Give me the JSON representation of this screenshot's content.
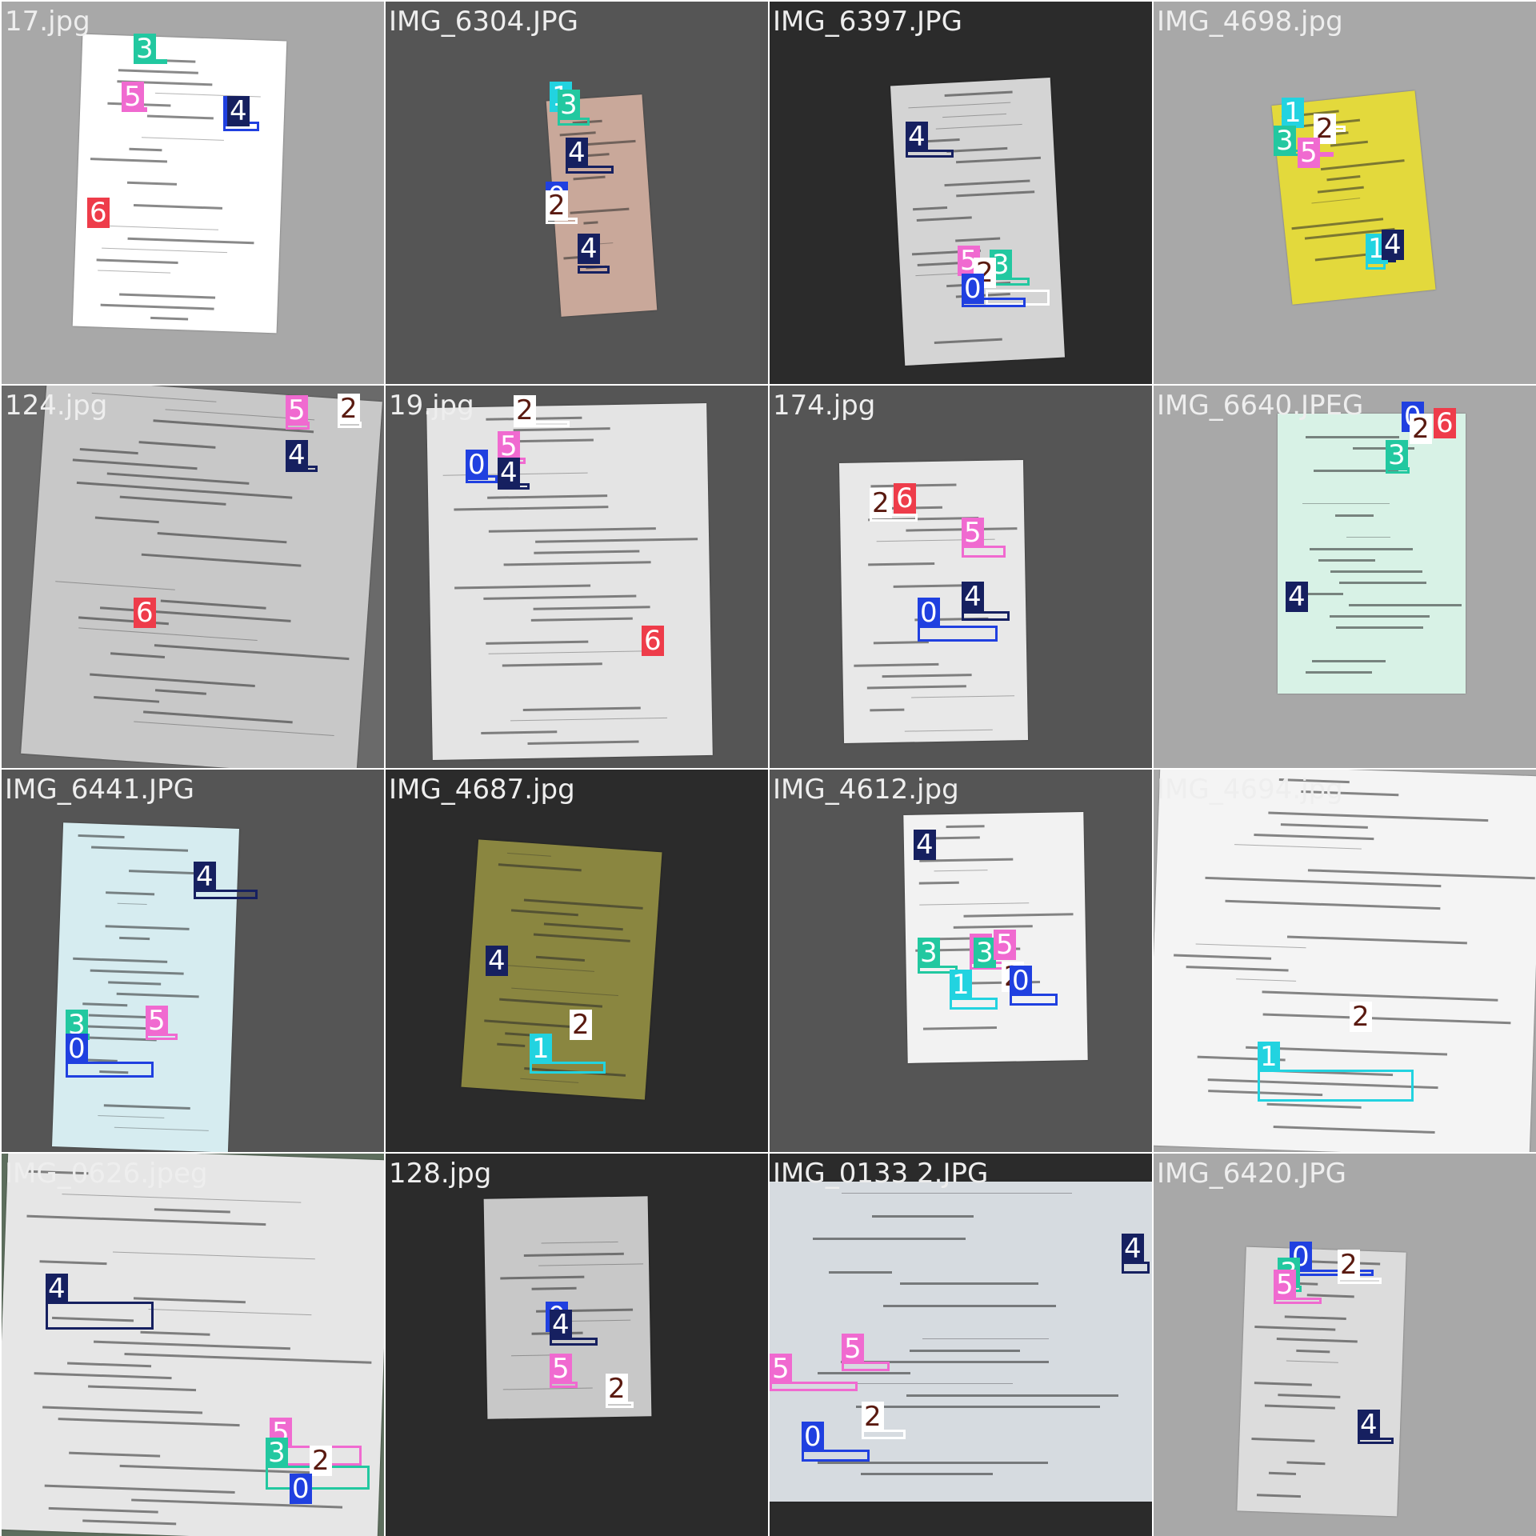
{
  "palette": {
    "0": "#2040e0",
    "1": "#22d3e0",
    "2": "#ffffff",
    "3": "#22c8a0",
    "4": "#162060",
    "5": "#f06ad0",
    "6": "#ee3c4a"
  },
  "tag_text_colors": {
    "0": "#ffffff",
    "1": "#ffffff",
    "2": "#5a1a10",
    "3": "#ffffff",
    "4": "#ffffff",
    "5": "#ffffff",
    "6": "#ffffff"
  },
  "cells": [
    {
      "title": "17.jpg",
      "background": "#a8a8a8",
      "doc": {
        "color": "#ffffff",
        "rotate": 2
      },
      "labels": [
        "3",
        "5",
        "0",
        "4",
        "6"
      ]
    },
    {
      "title": "IMG_6304.JPG",
      "background": "#555555",
      "doc": {
        "color": "#c9a89a",
        "rotate": -4
      },
      "labels": [
        "1",
        "3",
        "4",
        "0",
        "2",
        "4"
      ]
    },
    {
      "title": "IMG_6397.JPG",
      "background": "#2b2b2b",
      "doc": {
        "color": "#d4d4d4",
        "rotate": -3
      },
      "labels": [
        "4",
        "5",
        "3",
        "2",
        "0"
      ]
    },
    {
      "title": "IMG_4698.jpg",
      "background": "#a8a8a8",
      "doc": {
        "color": "#e3d93c",
        "rotate": -6
      },
      "labels": [
        "1",
        "2",
        "3",
        "5",
        "1",
        "4"
      ]
    },
    {
      "title": "124.jpg",
      "background": "#6a6a6a",
      "doc": {
        "color": "#c8c8c8",
        "rotate": 4
      },
      "labels": [
        "5",
        "2",
        "4",
        "6"
      ]
    },
    {
      "title": "19.jpg",
      "background": "#555555",
      "doc": {
        "color": "#e4e4e4",
        "rotate": -1
      },
      "labels": [
        "2",
        "5",
        "0",
        "4",
        "6"
      ]
    },
    {
      "title": "174.jpg",
      "background": "#555555",
      "doc": {
        "color": "#e8e8e8",
        "rotate": -1
      },
      "labels": [
        "2",
        "6",
        "5",
        "4",
        "0"
      ]
    },
    {
      "title": "IMG_6640.JPEG",
      "background": "#a8a8a8",
      "doc": {
        "color": "#d8f2e6",
        "rotate": 0
      },
      "labels": [
        "0",
        "2",
        "6",
        "3",
        "4"
      ]
    },
    {
      "title": "IMG_6441.JPG",
      "background": "#555555",
      "doc": {
        "color": "#d6ecf0",
        "rotate": 2
      },
      "labels": [
        "4",
        "3",
        "5",
        "0"
      ]
    },
    {
      "title": "IMG_4687.jpg",
      "background": "#2b2b2b",
      "doc": {
        "color": "#8a8640",
        "rotate": 4
      },
      "labels": [
        "4",
        "1",
        "2"
      ]
    },
    {
      "title": "IMG_4612.jpg",
      "background": "#555555",
      "doc": {
        "color": "#f2f2f2",
        "rotate": -1
      },
      "labels": [
        "4",
        "3",
        "5",
        "3",
        "5",
        "2",
        "1",
        "0"
      ]
    },
    {
      "title": "IMG_4694.jpg",
      "background": "#a8a8a8",
      "doc": {
        "color": "#f4f4f4",
        "rotate": 2
      },
      "labels": [
        "2",
        "1"
      ]
    },
    {
      "title": "IMG_0626.jpeg",
      "background": "#5d6e5d",
      "doc": {
        "color": "#e6e6e6",
        "rotate": 2
      },
      "labels": [
        "4",
        "5",
        "3",
        "2",
        "0"
      ]
    },
    {
      "title": "128.jpg",
      "background": "#2b2b2b",
      "doc": {
        "color": "#c8c8c8",
        "rotate": -1
      },
      "labels": [
        "0",
        "4",
        "5",
        "2"
      ]
    },
    {
      "title": "IMG_0133 2.JPG",
      "background": "#2b2b2b",
      "doc": {
        "color": "#d6dbe0",
        "rotate": 0
      },
      "labels": [
        "4",
        "5",
        "5",
        "2",
        "0"
      ]
    },
    {
      "title": "IMG_6420.JPG",
      "background": "#a8a8a8",
      "doc": {
        "color": "#dcdcdc",
        "rotate": 2
      },
      "labels": [
        "0",
        "2",
        "3",
        "5",
        "4"
      ]
    }
  ]
}
